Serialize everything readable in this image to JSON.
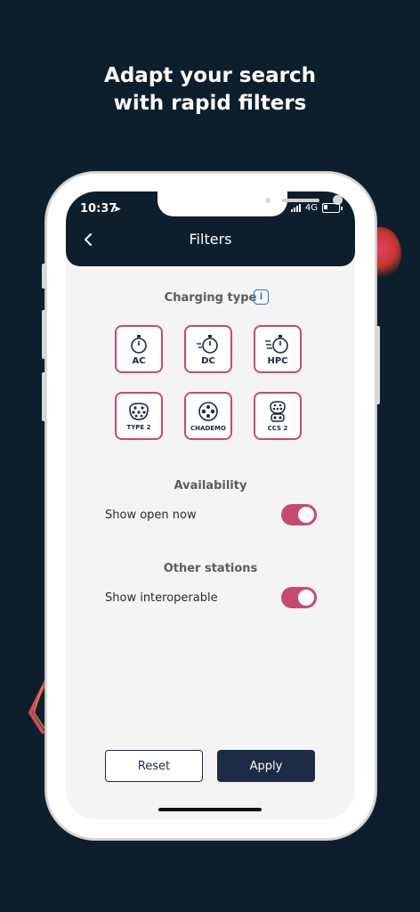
{
  "headline": {
    "line1": "Adapt your search",
    "line2": "with rapid filters"
  },
  "status_bar": {
    "time": "10:37",
    "network": "4G"
  },
  "header": {
    "title": "Filters"
  },
  "charging_type": {
    "title": "Charging type",
    "info_glyph": "i",
    "speed_options": [
      {
        "label": "AC",
        "icon": "stopwatch-icon"
      },
      {
        "label": "DC",
        "icon": "stopwatch-fast-icon"
      },
      {
        "label": "HPC",
        "icon": "stopwatch-faster-icon"
      }
    ],
    "connector_options": [
      {
        "label": "TYPE 2",
        "icon": "type2-connector-icon"
      },
      {
        "label": "CHADEMO",
        "icon": "chademo-connector-icon"
      },
      {
        "label": "CCS 2",
        "icon": "ccs2-connector-icon"
      }
    ]
  },
  "availability": {
    "title": "Availability",
    "label": "Show open now",
    "enabled": true
  },
  "other_stations": {
    "title": "Other stations",
    "label": "Show interoperable",
    "enabled": true
  },
  "actions": {
    "reset_label": "Reset",
    "apply_label": "Apply"
  },
  "colors": {
    "background": "#0d1f2d",
    "accent": "#c8496f",
    "button_dark": "#1d2b44",
    "info": "#3b68c4"
  }
}
